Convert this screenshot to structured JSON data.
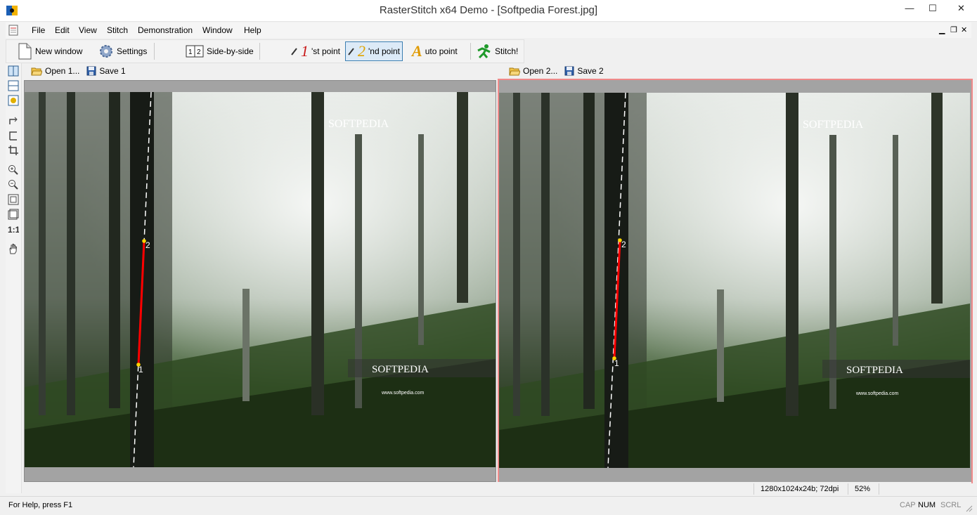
{
  "window": {
    "title": "RasterStitch x64 Demo - [Softpedia Forest.jpg]",
    "minimize_glyph": "—",
    "maximize_glyph": "☐",
    "close_glyph": "✕"
  },
  "menu": {
    "items": [
      "File",
      "Edit",
      "View",
      "Stitch",
      "Demonstration",
      "Window",
      "Help"
    ],
    "mdi_minimize": "▁",
    "mdi_restore": "❐",
    "mdi_close": "✕"
  },
  "toolbar": {
    "new_window": "New window",
    "settings": "Settings",
    "side_by_side": "Side-by-side",
    "first_point_digit": "1",
    "first_point": "'st point",
    "second_point_digit": "2",
    "second_point": "'nd point",
    "auto_point_letter": "A",
    "auto_point": "uto point",
    "stitch": "Stitch!"
  },
  "left_panel": {
    "open": "Open 1...",
    "save": "Save 1"
  },
  "right_panel": {
    "open": "Open 2...",
    "save": "Save 2"
  },
  "image": {
    "watermark_top": "SOFTPEDIA",
    "watermark_bottom": "SOFTPEDIA",
    "watermark_url": "www.softpedia.com",
    "point1_label": "1",
    "point2_label": "2"
  },
  "info": {
    "dimensions": "1280x1024x24b; 72dpi",
    "zoom": "52%"
  },
  "status": {
    "help": "For Help, press F1",
    "cap": "CAP",
    "num": "NUM",
    "scrl": "SCRL"
  },
  "colors": {
    "accent": "#3c7fb1",
    "active_border": "#f08a8a",
    "measure_line": "#ff0000"
  }
}
